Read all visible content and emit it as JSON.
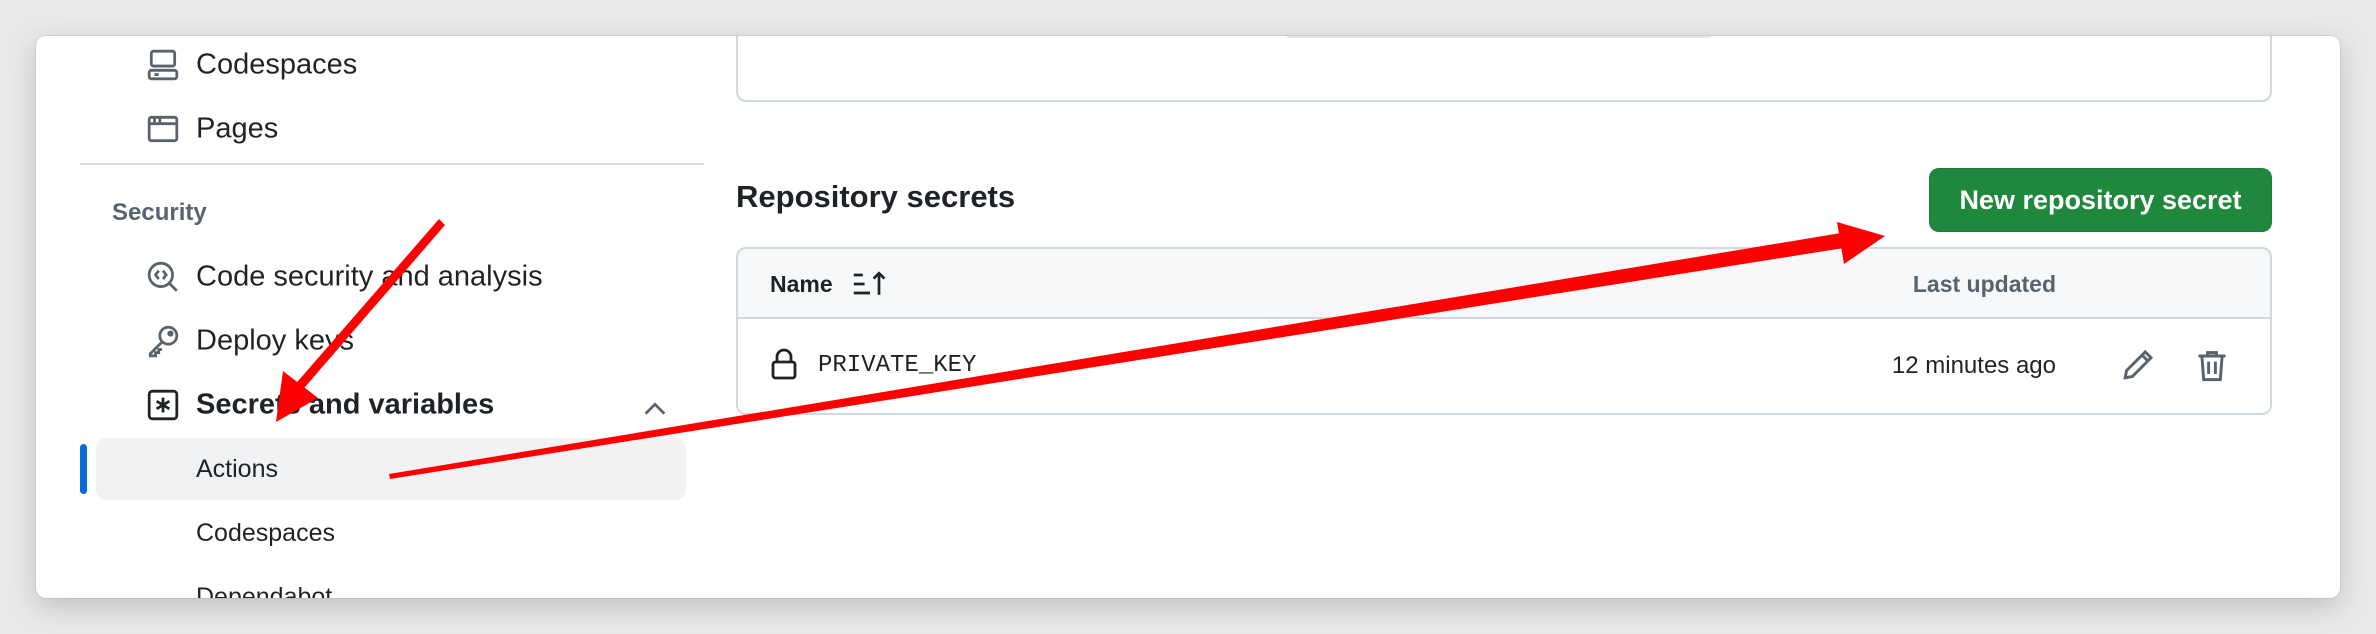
{
  "sidebar": {
    "items_top": [
      {
        "label": "Codespaces",
        "icon": "codespaces-icon"
      },
      {
        "label": "Pages",
        "icon": "browser-icon"
      }
    ],
    "security_heading": "Security",
    "security_items": [
      {
        "label": "Code security and analysis",
        "icon": "codescan-icon"
      },
      {
        "label": "Deploy keys",
        "icon": "key-icon"
      },
      {
        "label": "Secrets and variables",
        "icon": "asterisk-icon",
        "expanded": true
      }
    ],
    "secrets_children": [
      {
        "label": "Actions",
        "active": true
      },
      {
        "label": "Codespaces",
        "active": false
      },
      {
        "label": "Dependabot",
        "active": false
      }
    ]
  },
  "main": {
    "section_title": "Repository secrets",
    "new_secret_button": "New repository secret",
    "table": {
      "columns": {
        "name": "Name",
        "updated": "Last updated"
      },
      "rows": [
        {
          "name": "PRIVATE_KEY",
          "updated": "12 minutes ago",
          "icon": "lock-icon"
        }
      ]
    }
  },
  "colors": {
    "primary_button": "#1f883d",
    "active_indicator": "#0969da",
    "annotation_arrow": "#ff0000"
  }
}
